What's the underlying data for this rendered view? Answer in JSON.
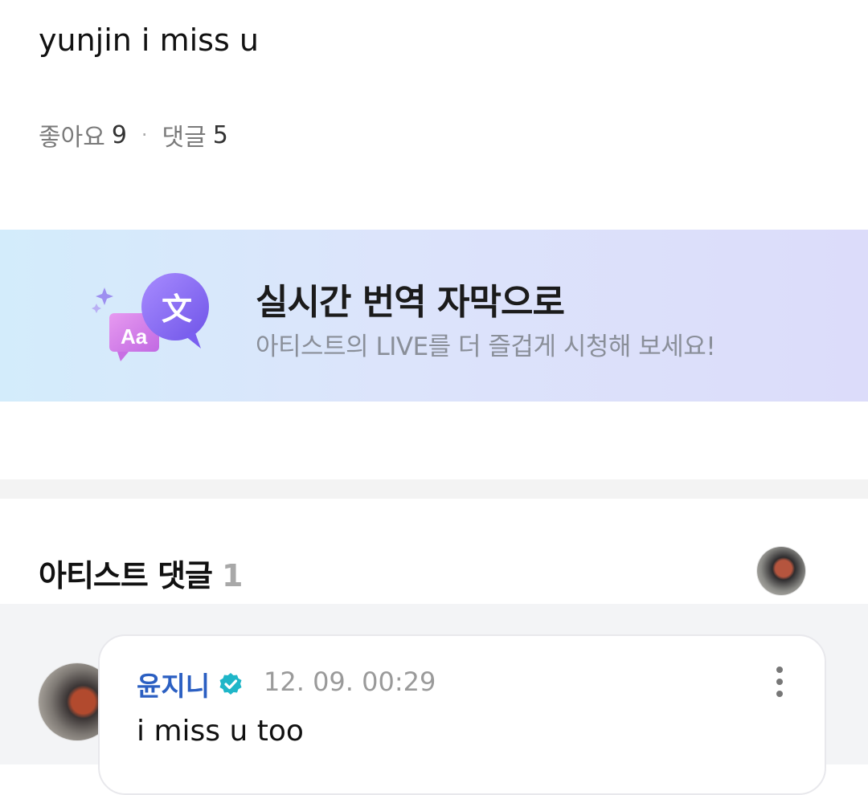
{
  "post": {
    "text": "yunjin i miss u",
    "likes_label": "좋아요",
    "likes_count": "9",
    "separator": "·",
    "comments_label": "댓글",
    "comments_count": "5"
  },
  "banner": {
    "title": "실시간 번역 자막으로",
    "subtitle": "아티스트의 LIVE를 더 즐겁게 시청해 보세요!",
    "icon_badge_glyph": "文",
    "icon_label_text": "Aa",
    "colors": {
      "bubble_purple": "#8b6cf0",
      "bubble_pink": "#d07ee8"
    }
  },
  "artist_comments": {
    "title": "아티스트 댓글",
    "count": "1"
  },
  "comment": {
    "author": "윤지니",
    "timestamp": "12. 09. 00:29",
    "text": "i miss u too",
    "verified_color": "#1fb6c8",
    "author_color": "#2b5fc2"
  }
}
